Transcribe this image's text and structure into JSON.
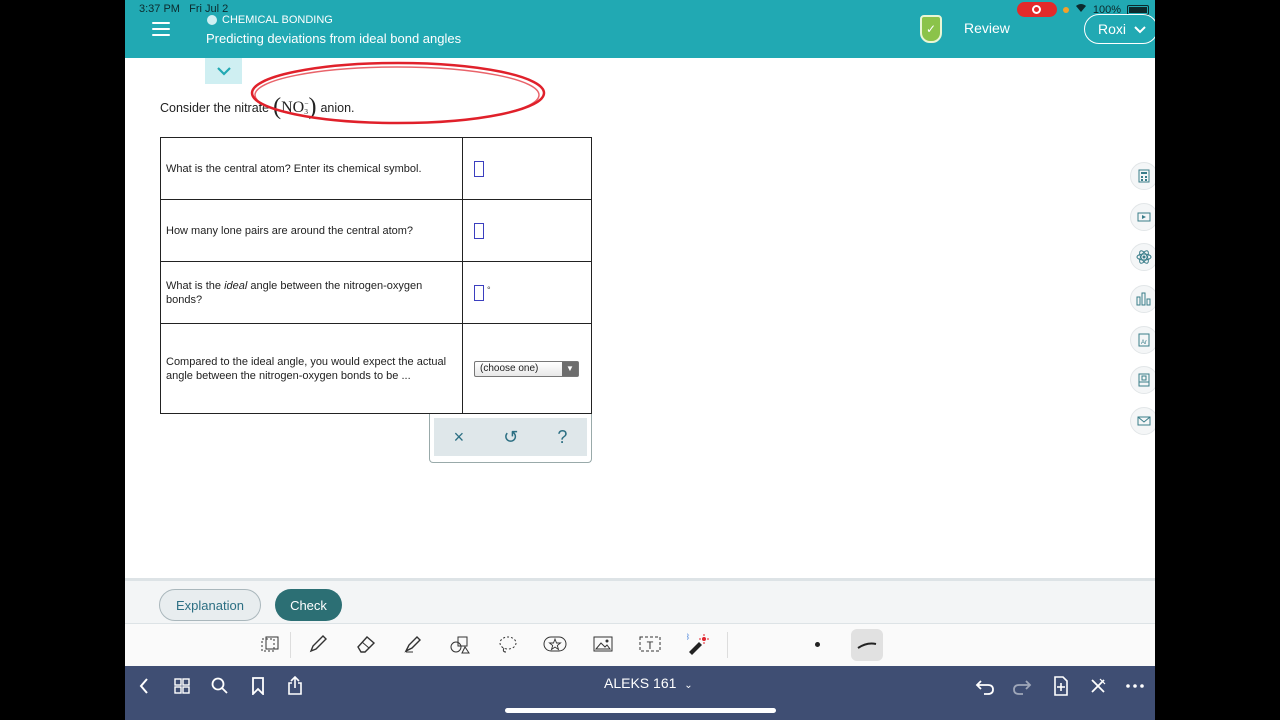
{
  "status_bar": {
    "time": "3:37 PM",
    "date": "Fri Jul 2",
    "battery": "100%"
  },
  "header": {
    "topic": "CHEMICAL BONDING",
    "title": "Predicting deviations from ideal bond angles",
    "review_label": "Review",
    "user_name": "Roxi"
  },
  "question": {
    "prompt_before": "Consider the nitrate",
    "formula_main": "NO",
    "formula_sub": "3",
    "formula_sup": "−",
    "prompt_after": "anion."
  },
  "table": {
    "rows": [
      {
        "question": "What is the central atom? Enter its chemical symbol."
      },
      {
        "question": "How many lone pairs are around the central atom?"
      },
      {
        "question_before": "What is the ",
        "question_emph": "ideal",
        "question_after": " angle between the nitrogen-oxygen bonds?",
        "unit": "°"
      },
      {
        "question": "Compared to the ideal angle, you would expect the actual angle between the nitrogen-oxygen bonds to be ...",
        "select_value": "(choose one)"
      }
    ]
  },
  "actions": {
    "clear": "×",
    "undo": "↺",
    "help": "?"
  },
  "footer": {
    "explanation_label": "Explanation",
    "check_label": "Check"
  },
  "nav": {
    "title": "ALEKS 161"
  },
  "colors": {
    "header": "#21a9b3",
    "check_button": "#2c6f74",
    "nav_bar": "#3f4e73",
    "annotation": "#e0212b"
  }
}
